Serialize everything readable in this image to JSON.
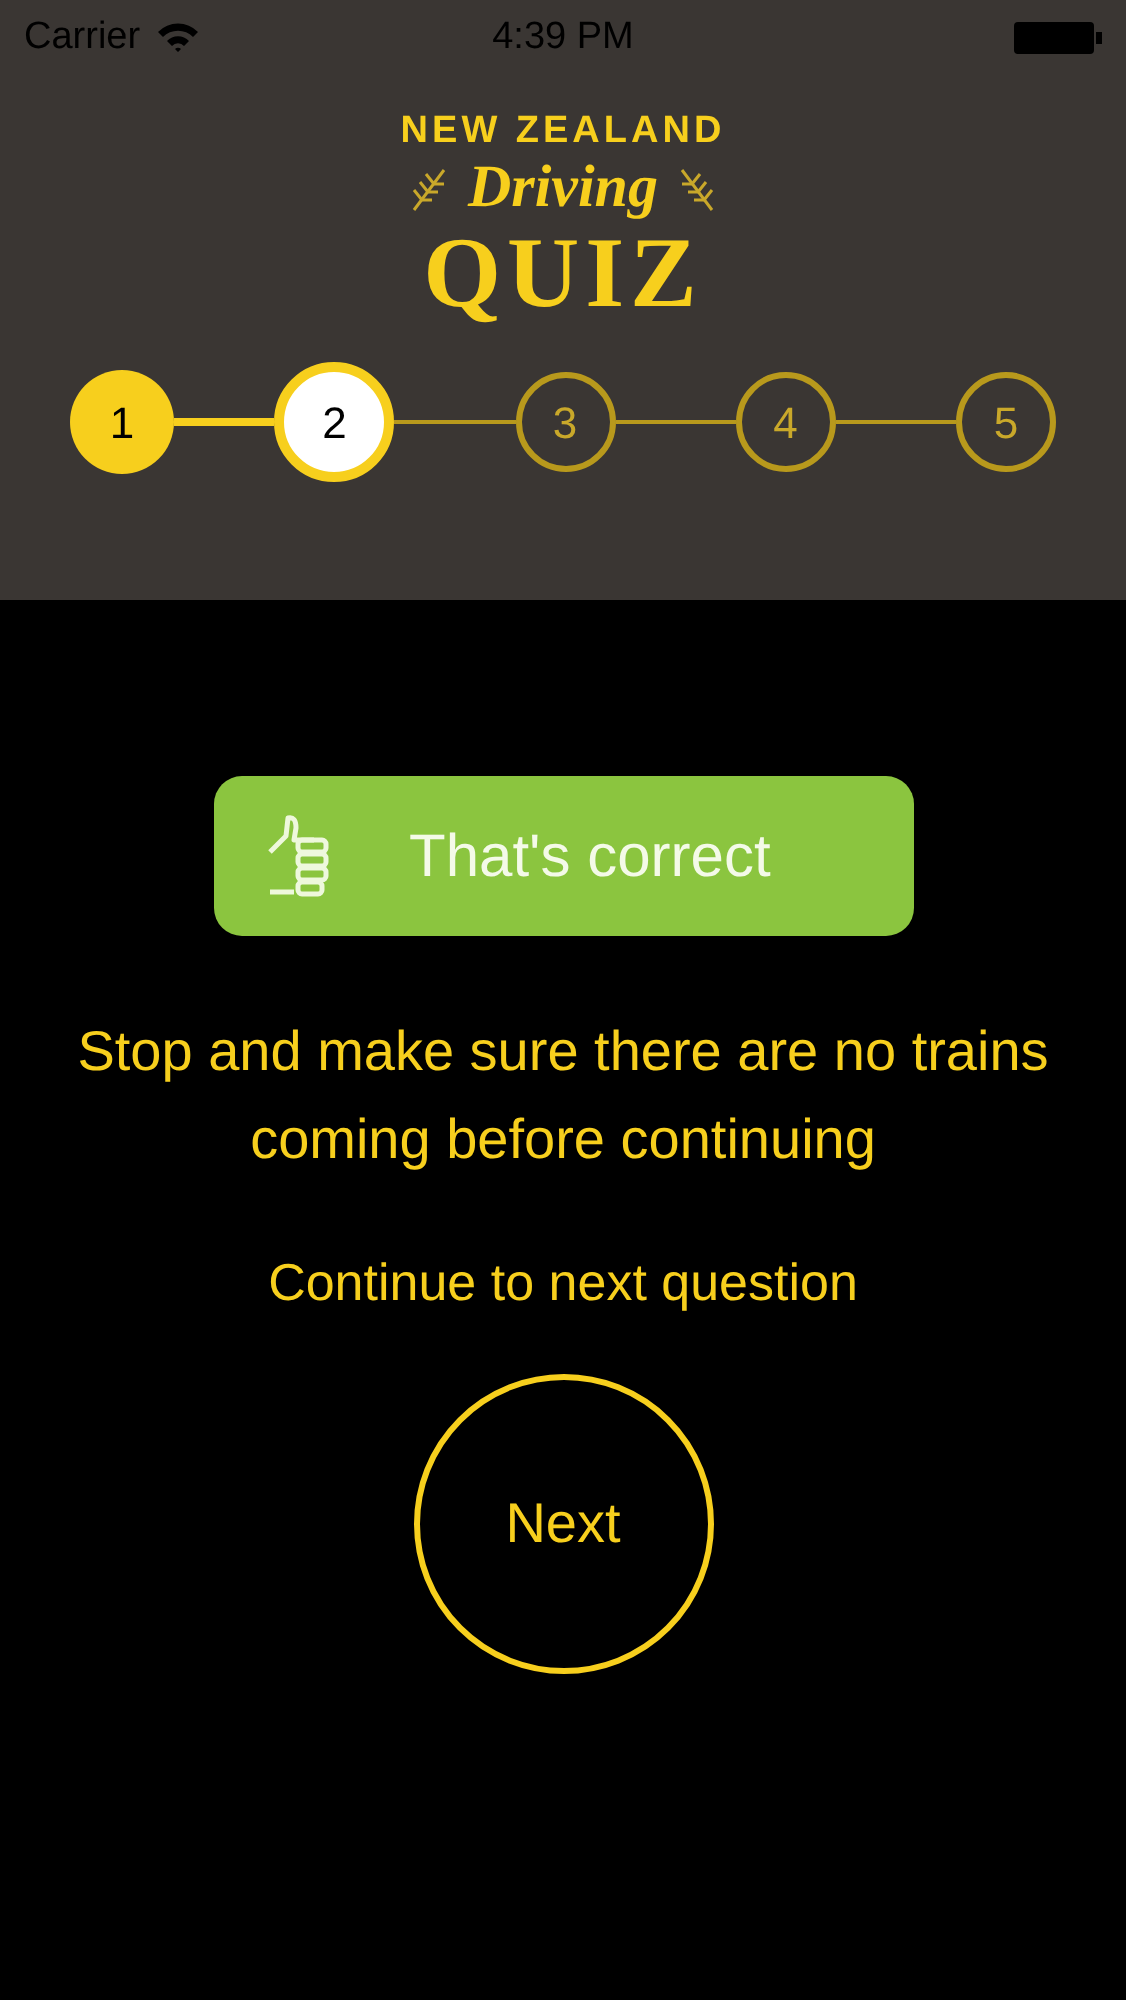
{
  "status_bar": {
    "carrier": "Carrier",
    "time": "4:39 PM"
  },
  "logo": {
    "line_1": "NEW ZEALAND",
    "line_2": "Driving",
    "line_3": "QUIZ"
  },
  "steps": [
    {
      "label": "1",
      "kind": "done"
    },
    {
      "label": "2",
      "kind": "current"
    },
    {
      "label": "3",
      "kind": "upcoming"
    },
    {
      "label": "4",
      "kind": "upcoming"
    },
    {
      "label": "5",
      "kind": "upcoming"
    }
  ],
  "result": {
    "label": "That's correct"
  },
  "explanation": "Stop and make sure there are no trains coming before continuing",
  "prompt": "Continue to next question",
  "next_button": "Next"
}
